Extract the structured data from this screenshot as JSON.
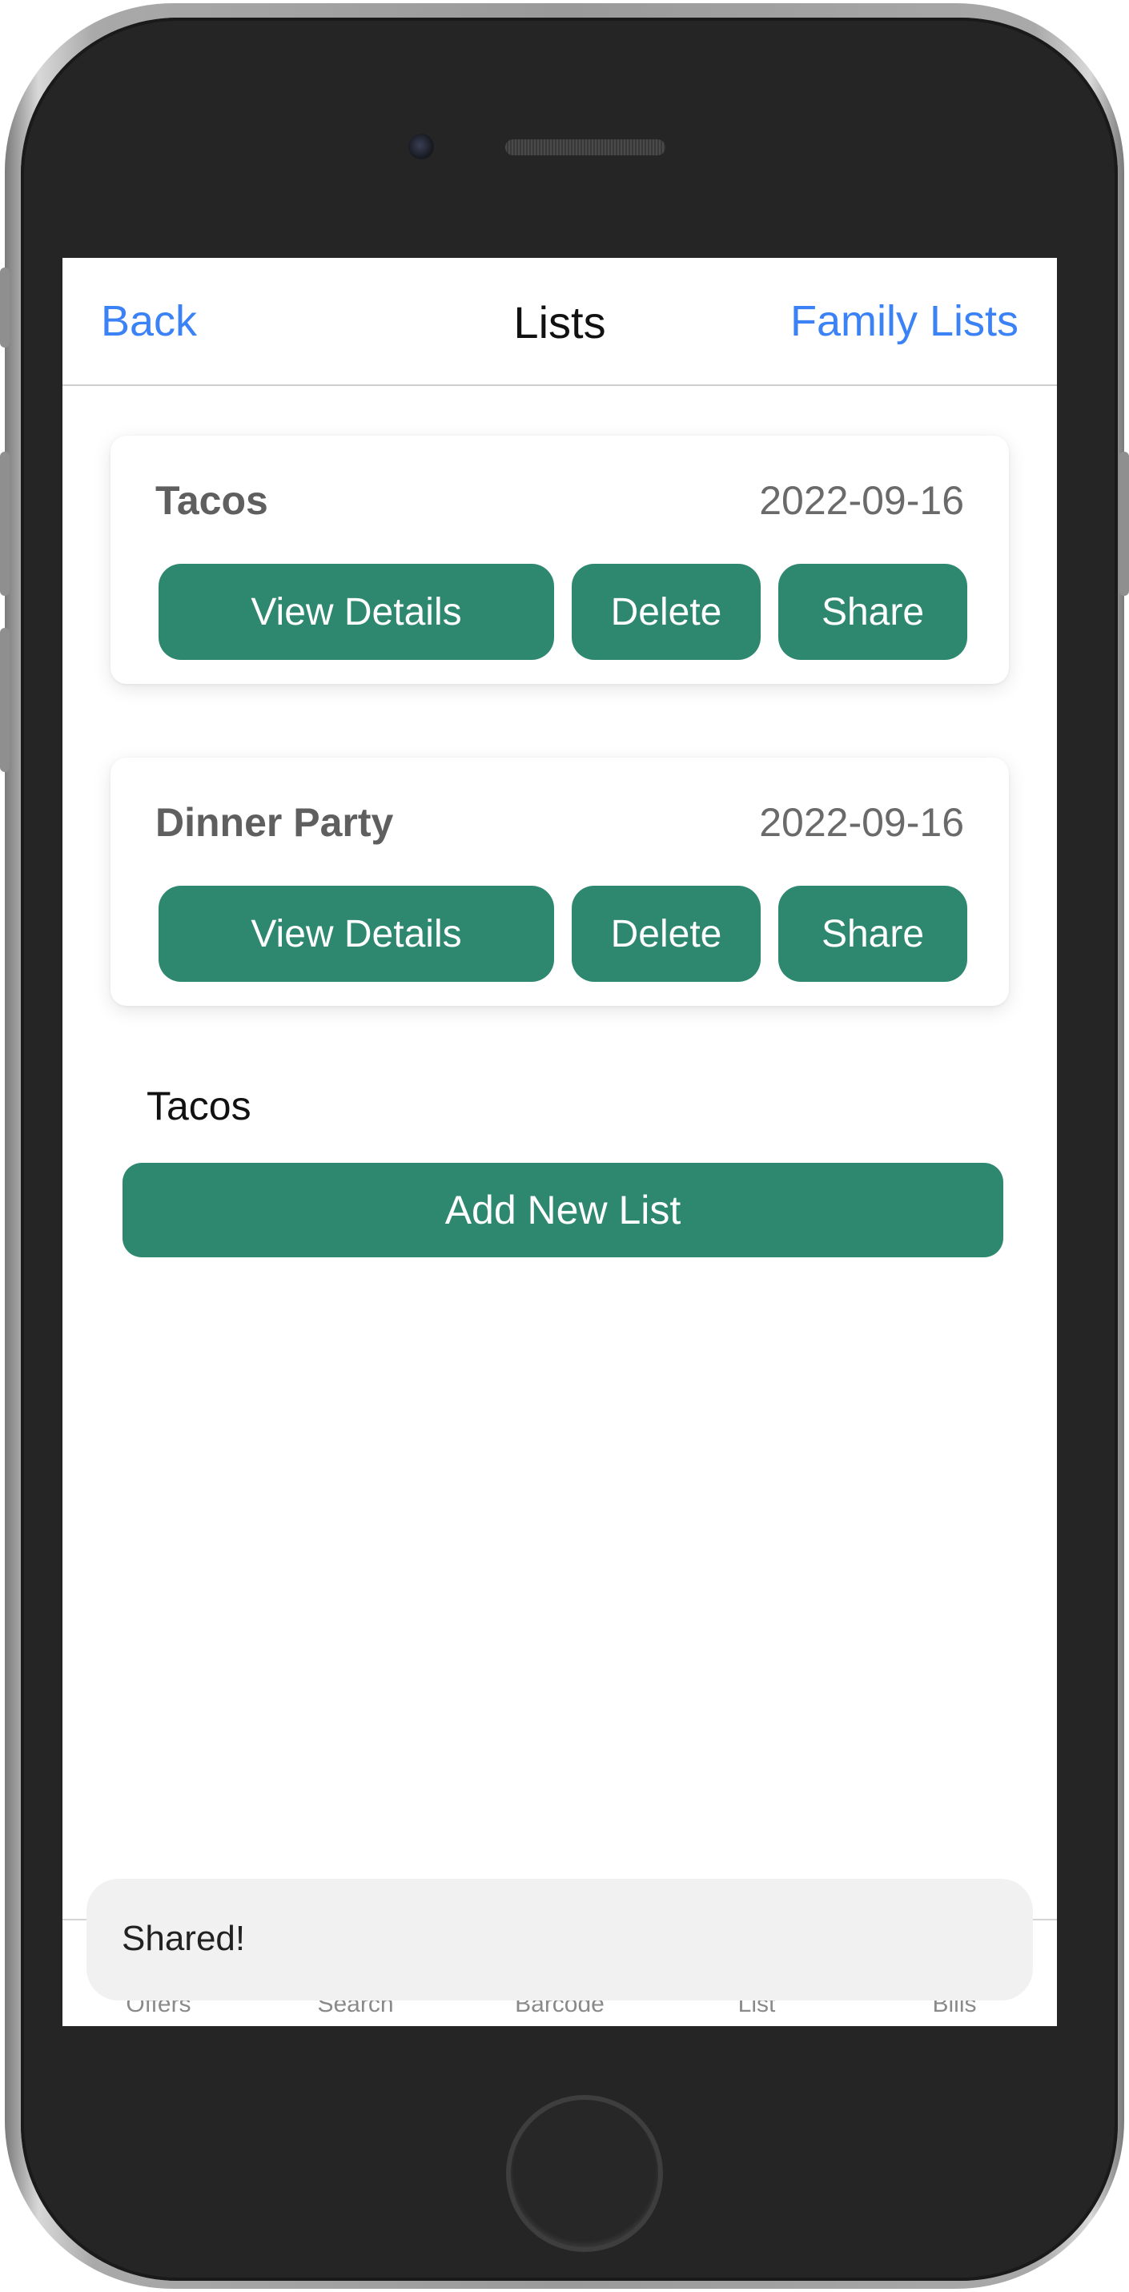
{
  "nav": {
    "back_label": "Back",
    "title": "Lists",
    "family_label": "Family Lists"
  },
  "lists": [
    {
      "name": "Tacos",
      "date": "2022-09-16",
      "view_label": "View Details",
      "delete_label": "Delete",
      "share_label": "Share"
    },
    {
      "name": "Dinner Party",
      "date": "2022-09-16",
      "view_label": "View Details",
      "delete_label": "Delete",
      "share_label": "Share"
    }
  ],
  "new_list": {
    "input_value": "Tacos",
    "add_label": "Add New List"
  },
  "tabs": [
    "Offers",
    "Search",
    "Barcode",
    "List",
    "Bills"
  ],
  "toast": {
    "message": "Shared!"
  },
  "colors": {
    "accent_green": "#2e8870",
    "link_blue": "#3b82f6"
  }
}
